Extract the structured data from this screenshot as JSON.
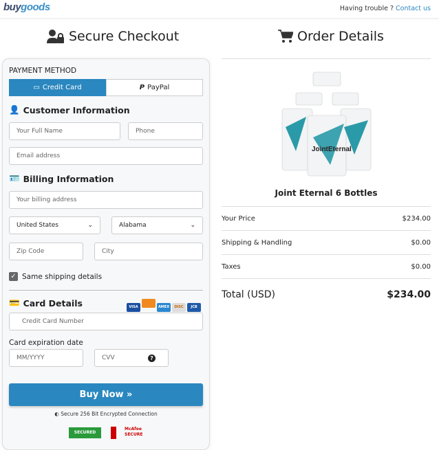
{
  "header": {
    "logo_a": "buy",
    "logo_b": "goods",
    "trouble": "Having trouble ?",
    "contact": "Contact us"
  },
  "left": {
    "title": "Secure Checkout",
    "payment_method": "PAYMENT METHOD",
    "tabs": [
      {
        "label": "Credit Card",
        "active": true
      },
      {
        "label": "PayPal",
        "active": false
      }
    ],
    "customer": {
      "title": "Customer Information",
      "name_ph": "Your Full Name",
      "phone_ph": "Phone",
      "email_ph": "Email address"
    },
    "billing": {
      "title": "Billing Information",
      "address_ph": "Your billing address",
      "country": "United States",
      "state": "Alabama",
      "zip_ph": "Zip Code",
      "city_ph": "City",
      "same_shipping": "Same shipping details",
      "same_checked": true
    },
    "card": {
      "title": "Card Details",
      "brands": [
        "VISA",
        "MC",
        "AMEX",
        "DISCOVER",
        "JCB"
      ],
      "number_ph": "Credit Card Number",
      "exp_label": "Card expiration date",
      "exp_ph": "MM/YYYY",
      "cvv_ph": "CVV"
    },
    "buy": "Buy Now »",
    "secure": "Secure 256 Bit Encrypted Connection",
    "badges": [
      "SECURED",
      "McAfee SECURE"
    ]
  },
  "right": {
    "title": "Order Details",
    "product": "Joint Eternal 6 Bottles",
    "bottle_brand": "JointEternal",
    "rows": [
      {
        "label": "Your Price",
        "value": "$234.00"
      },
      {
        "label": "Shipping & Handling",
        "value": "$0.00"
      },
      {
        "label": "Taxes",
        "value": "$0.00"
      }
    ],
    "total_label": "Total (USD)",
    "total_value": "$234.00"
  },
  "colors": {
    "accent": "#2a87bf"
  }
}
